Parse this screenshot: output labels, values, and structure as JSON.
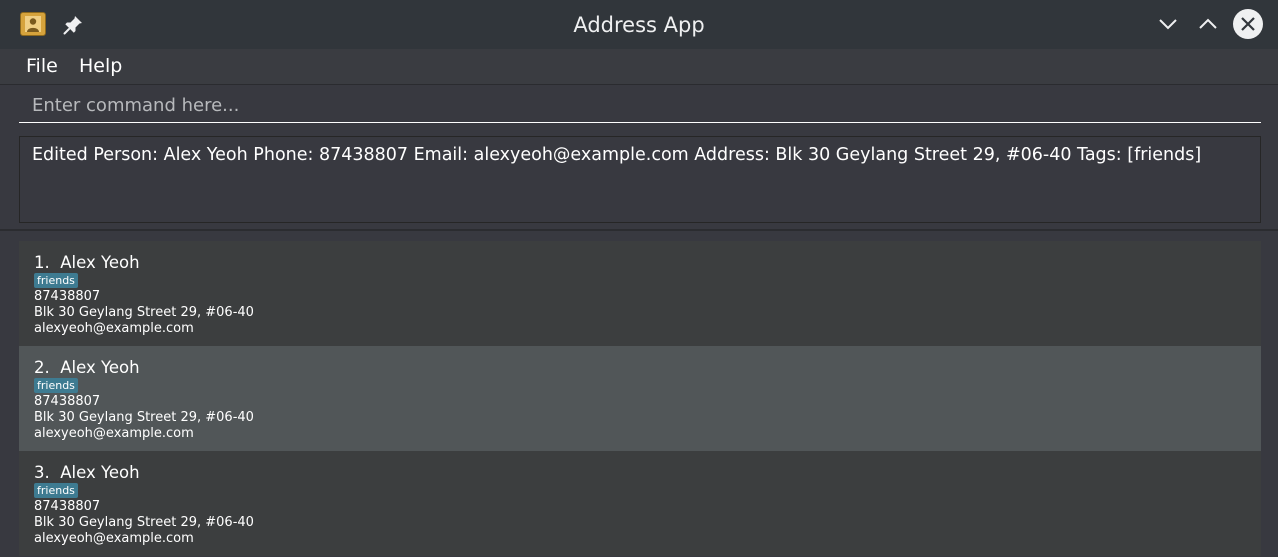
{
  "window": {
    "title": "Address App"
  },
  "menu": {
    "file": "File",
    "help": "Help"
  },
  "command": {
    "placeholder": "Enter command here...",
    "value": ""
  },
  "result": {
    "text": "Edited Person: Alex Yeoh Phone: 87438807 Email: alexyeoh@example.com Address: Blk 30 Geylang Street 29, #06-40 Tags: [friends]"
  },
  "persons": [
    {
      "index": "1.",
      "name": "Alex Yeoh",
      "tag": "friends",
      "phone": "87438807",
      "address": "Blk 30 Geylang Street 29, #06-40",
      "email": "alexyeoh@example.com"
    },
    {
      "index": "2.",
      "name": "Alex Yeoh",
      "tag": "friends",
      "phone": "87438807",
      "address": "Blk 30 Geylang Street 29, #06-40",
      "email": "alexyeoh@example.com",
      "selected": true
    },
    {
      "index": "3.",
      "name": "Alex Yeoh",
      "tag": "friends",
      "phone": "87438807",
      "address": "Blk 30 Geylang Street 29, #06-40",
      "email": "alexyeoh@example.com"
    }
  ],
  "colors": {
    "window_bg": "#383940",
    "titlebar_bg": "#31363b",
    "selected_row": "#515658",
    "tag_bg": "#3e7b91"
  },
  "icons": {
    "app": "address-book-icon",
    "pin": "pin-icon",
    "minimize": "chevron-down-icon",
    "maximize": "chevron-up-icon",
    "close": "close-icon"
  }
}
